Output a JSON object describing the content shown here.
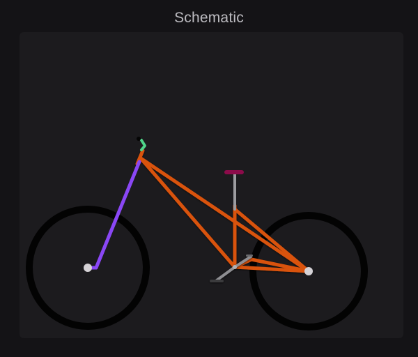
{
  "window": {
    "title": "Schematic"
  },
  "bike": {
    "colors": {
      "background": "#141316",
      "panel": "#1c1b1e",
      "tire": "#030303",
      "frame": "#d9530d",
      "fork": "#8a47f5",
      "stem": "#4fd58a",
      "seat": "#8c0b4a",
      "seatpost": "#9c9ca0",
      "crank": "#8e8e92",
      "hub": "#d5d2d6"
    },
    "icons": {
      "front_wheel": "wheel-icon",
      "rear_wheel": "wheel-icon",
      "saddle": "saddle-icon"
    }
  }
}
